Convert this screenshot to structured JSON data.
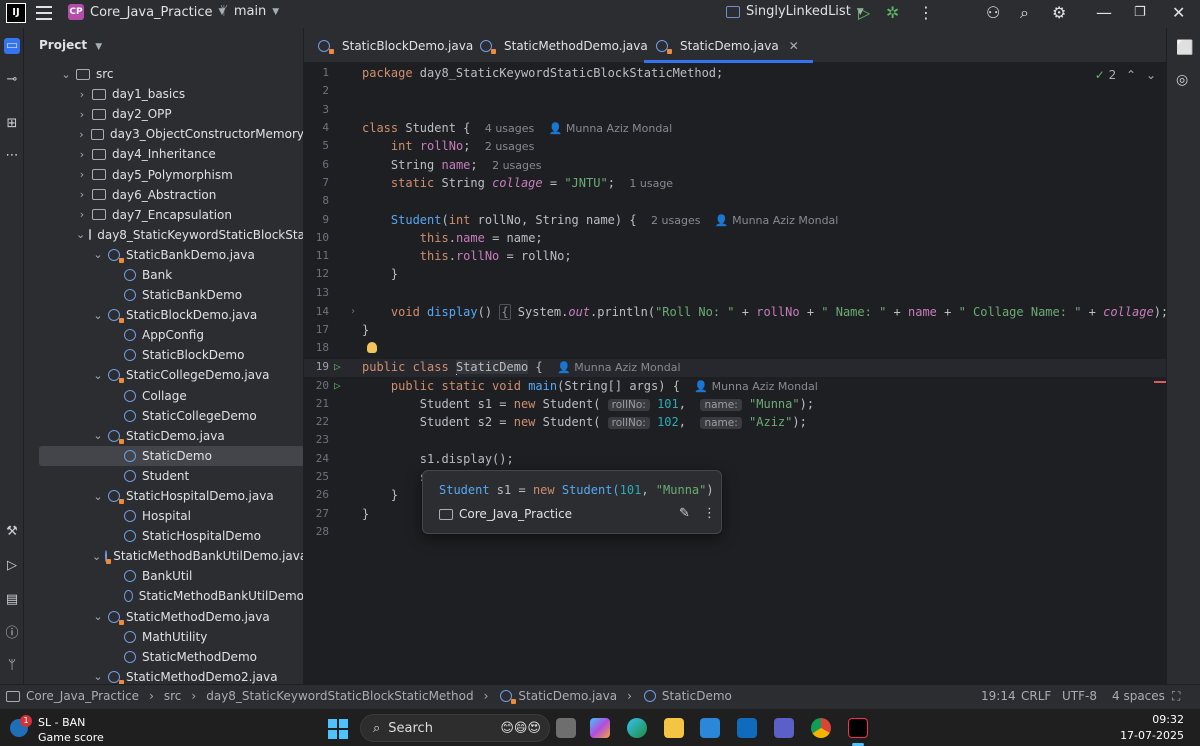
{
  "titlebar": {
    "logo": "IJ",
    "project_badge": "CP",
    "project_name": "Core_Java_Practice",
    "branch": "main",
    "run_config": "SinglyLinkedList"
  },
  "project_panel": {
    "title": "Project",
    "tree": [
      {
        "label": "src",
        "depth": 1,
        "kind": "folder",
        "expanded": true
      },
      {
        "label": "day1_basics",
        "depth": 2,
        "kind": "folder"
      },
      {
        "label": "day2_OPP",
        "depth": 2,
        "kind": "folder"
      },
      {
        "label": "day3_ObjectConstructorMemory",
        "depth": 2,
        "kind": "folder"
      },
      {
        "label": "day4_Inheritance",
        "depth": 2,
        "kind": "folder"
      },
      {
        "label": "day5_Polymorphism",
        "depth": 2,
        "kind": "folder"
      },
      {
        "label": "day6_Abstraction",
        "depth": 2,
        "kind": "folder"
      },
      {
        "label": "day7_Encapsulation",
        "depth": 2,
        "kind": "folder"
      },
      {
        "label": "day8_StaticKeywordStaticBlockStaticMethod",
        "depth": 2,
        "kind": "folder",
        "expanded": true
      },
      {
        "label": "StaticBankDemo.java",
        "depth": 3,
        "kind": "file",
        "expanded": true
      },
      {
        "label": "Bank",
        "depth": 4,
        "kind": "class"
      },
      {
        "label": "StaticBankDemo",
        "depth": 4,
        "kind": "class"
      },
      {
        "label": "StaticBlockDemo.java",
        "depth": 3,
        "kind": "file",
        "expanded": true
      },
      {
        "label": "AppConfig",
        "depth": 4,
        "kind": "class"
      },
      {
        "label": "StaticBlockDemo",
        "depth": 4,
        "kind": "class"
      },
      {
        "label": "StaticCollegeDemo.java",
        "depth": 3,
        "kind": "file",
        "expanded": true
      },
      {
        "label": "Collage",
        "depth": 4,
        "kind": "class"
      },
      {
        "label": "StaticCollegeDemo",
        "depth": 4,
        "kind": "class"
      },
      {
        "label": "StaticDemo.java",
        "depth": 3,
        "kind": "file",
        "expanded": true
      },
      {
        "label": "StaticDemo",
        "depth": 4,
        "kind": "class",
        "selected": true
      },
      {
        "label": "Student",
        "depth": 4,
        "kind": "class"
      },
      {
        "label": "StaticHospitalDemo.java",
        "depth": 3,
        "kind": "file",
        "expanded": true
      },
      {
        "label": "Hospital",
        "depth": 4,
        "kind": "class"
      },
      {
        "label": "StaticHospitalDemo",
        "depth": 4,
        "kind": "class"
      },
      {
        "label": "StaticMethodBankUtilDemo.java",
        "depth": 3,
        "kind": "file",
        "expanded": true
      },
      {
        "label": "BankUtil",
        "depth": 4,
        "kind": "class"
      },
      {
        "label": "StaticMethodBankUtilDemo",
        "depth": 4,
        "kind": "class"
      },
      {
        "label": "StaticMethodDemo.java",
        "depth": 3,
        "kind": "file",
        "expanded": true
      },
      {
        "label": "MathUtility",
        "depth": 4,
        "kind": "class"
      },
      {
        "label": "StaticMethodDemo",
        "depth": 4,
        "kind": "class"
      },
      {
        "label": "StaticMethodDemo2.java",
        "depth": 3,
        "kind": "file",
        "expanded": true
      }
    ]
  },
  "tabs": [
    {
      "label": "StaticBlockDemo.java"
    },
    {
      "label": "StaticMethodDemo.java"
    },
    {
      "label": "StaticDemo.java",
      "active": true
    }
  ],
  "editor": {
    "inspection_count": "2",
    "hints": {
      "usages4": "4 usages",
      "usages2": "2 usages",
      "usage1": "1 usage",
      "author": "Munna Aziz Mondal",
      "rollNo": "rollNo:",
      "name": "name:"
    },
    "code": {
      "l1_kw": "package",
      "l1_rest": " day8_StaticKeywordStaticBlockStaticMethod;",
      "l4_kw": "class",
      "l4_rest": " Student {",
      "l5_kw": "int",
      "l5_fld": "rollNo",
      "l6_type": "String",
      "l6_fld": "name",
      "l7_kw": "static",
      "l7_type": " String ",
      "l7_fld": "collage",
      "l7_str": "\"JNTU\"",
      "l9_ctor": "Student",
      "l9_params_a": "(",
      "l9_int": "int",
      "l9_params_b": " rollNo, String name) {",
      "l10_this": "this",
      "l10_fld": "name",
      "l10_rest": " = name;",
      "l11_this": "this",
      "l11_fld": "rollNo",
      "l11_rest": " = rollNo;",
      "l12": "}",
      "l14_kw": "void",
      "l14_fn": "display",
      "l14_a": " System.",
      "l14_out": "out",
      "l14_b": ".println(",
      "l14_s1": "\"Roll No: \"",
      "l14_c": " + ",
      "l14_f1": "rollNo",
      "l14_s2": "\" Name: \"",
      "l14_f2": "name",
      "l14_s3": "\" Collage Name: \"",
      "l14_f3": "collage",
      "l14_d": ");",
      "l15": "}",
      "l17_kw": "public class",
      "l17_cls": "StaticDemo",
      "l17_rest": " {",
      "l18_kw": "public static void",
      "l18_fn": "main",
      "l18_rest": "(String[] args) {",
      "l19_a": "Student s1 = ",
      "l19_kw": "new",
      "l19_b": " Student(",
      "l19_n": "101",
      "l19_s": "\"Munna\"",
      "l19_c": ");",
      "l20_a": "Student s2 = ",
      "l20_kw": "new",
      "l20_b": " Student(",
      "l20_n": "102",
      "l20_s": "\"Aziz\"",
      "l20_c": ");",
      "l22": "s1.display();",
      "l23": "s",
      "l24": "}",
      "l25": "}"
    },
    "line_numbers": [
      "1",
      "2",
      "3",
      "4",
      "5",
      "6",
      "7",
      "8",
      "9",
      "10",
      "11",
      "12",
      "13",
      "14",
      "17",
      "18",
      "19",
      "20",
      "21",
      "22",
      "23",
      "24",
      "25",
      "26",
      "27",
      "28"
    ]
  },
  "popup": {
    "code_a": "Student",
    "code_b": " s1 = ",
    "code_kw": "new",
    "code_c": " Student(",
    "code_n": "101",
    "code_d": ", ",
    "code_s": "\"Munna\"",
    "code_e": ")",
    "project": "Core_Java_Practice"
  },
  "statusbar": {
    "crumbs": [
      "Core_Java_Practice",
      "src",
      "day8_StaticKeywordStaticBlockStaticMethod",
      "StaticDemo.java",
      "StaticDemo"
    ],
    "position": "19:14",
    "line_sep": "CRLF",
    "encoding": "UTF-8",
    "indent": "4 spaces"
  },
  "taskbar": {
    "weather_title": "SL - BAN",
    "weather_sub": "Game score",
    "badge": "1",
    "search": "Search",
    "time": "09:32",
    "date": "17-07-2025"
  },
  "colors": {
    "accent": "#3574f0",
    "keyword": "#cf8e6d",
    "string": "#6aab73",
    "number": "#2aacb8",
    "field": "#c77dbb",
    "function": "#56a8f5"
  }
}
